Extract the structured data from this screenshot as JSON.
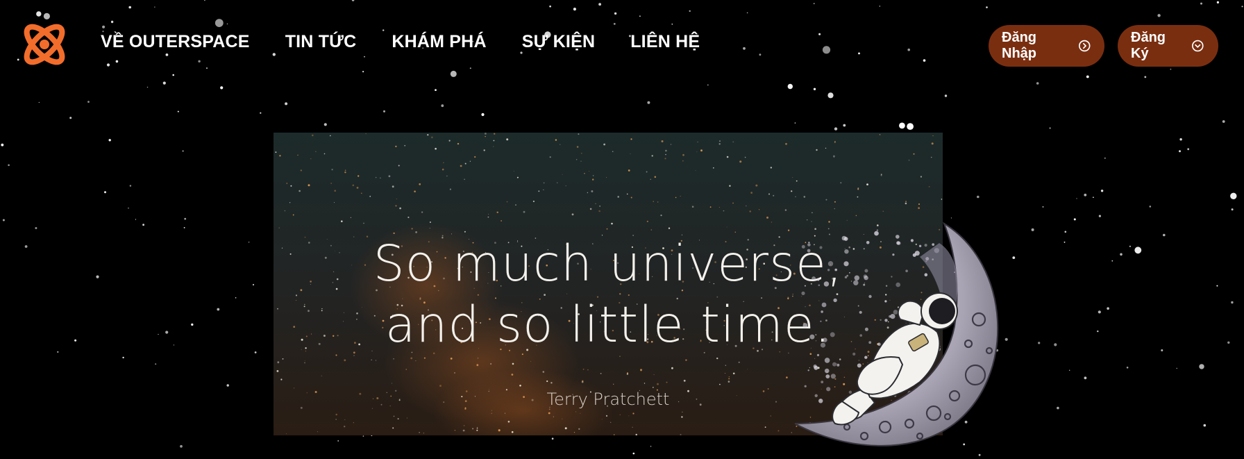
{
  "nav": {
    "logo_alt": "Outerspace logo",
    "items": [
      {
        "label": "VỀ OUTERSPACE"
      },
      {
        "label": "TIN TỨC"
      },
      {
        "label": "KHÁM PHÁ"
      },
      {
        "label": "SỰ KIỆN"
      },
      {
        "label": "LIÊN HỆ"
      }
    ]
  },
  "auth": {
    "login_label": "Đăng Nhập",
    "login_icon": "circle-chevron-right-icon",
    "signup_label": "Đăng Ký",
    "signup_icon": "circle-chevron-down-icon"
  },
  "hero": {
    "quote_line1": "So much universe,",
    "quote_line2": "and so little time.",
    "author": "Terry Pratchett"
  },
  "colors": {
    "background": "#000000",
    "logo_orange": "#f26d2b",
    "button_bg": "#7a2e10",
    "hero_bg_top": "#1d2b2b",
    "hero_bg_bottom": "#2a1c12"
  }
}
